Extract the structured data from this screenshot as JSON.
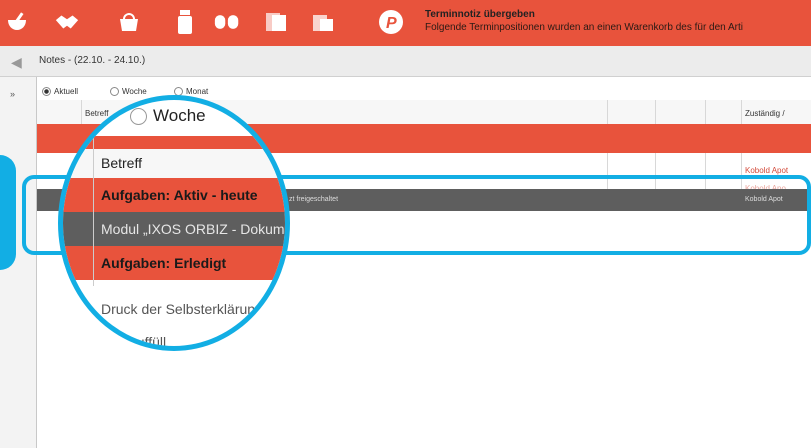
{
  "toolbar": {
    "icons": [
      "mortar-pestle-icon",
      "handshake-icon",
      "basket-icon",
      "medicine-bottle-icon",
      "pills-icon",
      "document-stack-icon",
      "box-icon",
      "p-logo-icon"
    ],
    "notification_title": "Terminnotiz übergeben",
    "notification_text": "Folgende Terminpositionen wurden an einen Warenkorb des für den Arti"
  },
  "panel": {
    "title": "Notes - (22.10. - 24.10.)",
    "collapse_label": "»"
  },
  "filters": {
    "options": [
      "Aktuell",
      "Woche",
      "Monat"
    ],
    "selected": "Aktuell"
  },
  "grid": {
    "headers": {
      "subject": "Betreff",
      "subject_radio": "Woche",
      "responsible": "Zuständig / "
    },
    "rows": [
      {
        "responsible": "Kobold Apot"
      },
      {
        "responsible": "Kobold Apo"
      },
      {
        "description": "zt freigeschaltet",
        "responsible": "Kobold Apot"
      }
    ]
  },
  "magnifier": {
    "radio_label": "Woche",
    "header": "Betreff",
    "group_active": "Aufgaben: Aktiv - heute",
    "selected_item": "Modul „IXOS ORBIZ - Dokum",
    "group_done": "Aufgaben: Erledigt",
    "item_1": "Druck der Selbsterklärun",
    "item_2": "orte auffüll"
  },
  "colors": {
    "accent": "#e8533c",
    "highlight": "#12aee4",
    "selected_row": "#5e5e5e"
  }
}
